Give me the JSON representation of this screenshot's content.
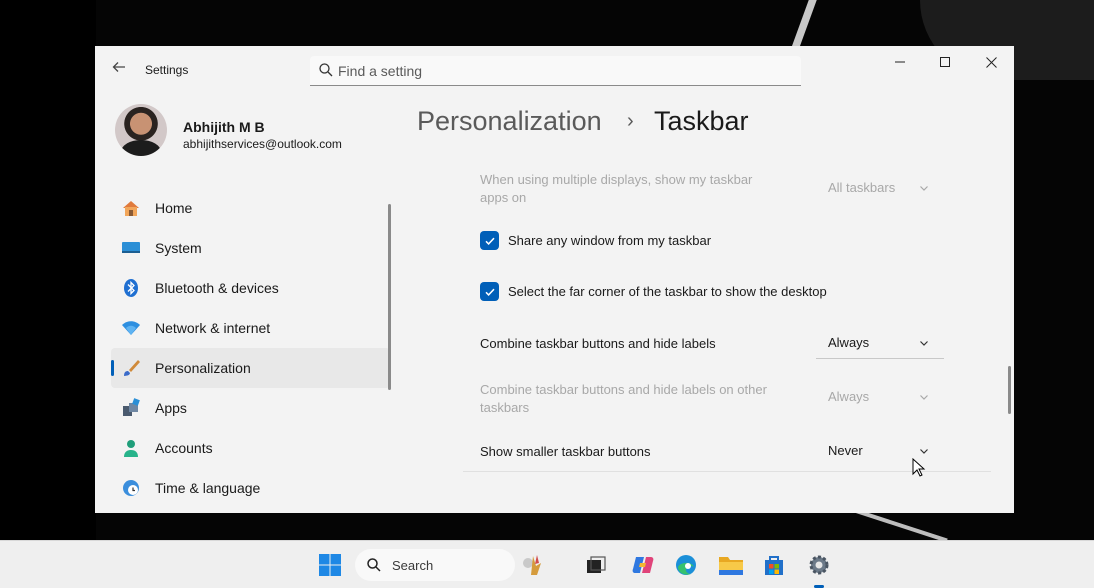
{
  "window": {
    "app_title": "Settings",
    "search_placeholder": "Find a setting"
  },
  "profile": {
    "name": "Abhijith M B",
    "email": "abhijithservices@outlook.com"
  },
  "nav": {
    "items": [
      {
        "label": "Home",
        "icon": "home-icon"
      },
      {
        "label": "System",
        "icon": "system-icon"
      },
      {
        "label": "Bluetooth & devices",
        "icon": "bluetooth-icon"
      },
      {
        "label": "Network & internet",
        "icon": "wifi-icon"
      },
      {
        "label": "Personalization",
        "icon": "brush-icon",
        "active": true
      },
      {
        "label": "Apps",
        "icon": "apps-icon"
      },
      {
        "label": "Accounts",
        "icon": "accounts-icon"
      },
      {
        "label": "Time & language",
        "icon": "globe-clock-icon"
      }
    ]
  },
  "header": {
    "parent": "Personalization",
    "separator": "›",
    "current": "Taskbar"
  },
  "settings": {
    "multi_display": {
      "label": "When using multiple displays, show my taskbar apps on",
      "value": "All taskbars",
      "disabled": true
    },
    "share_window": {
      "label": "Share any window from my taskbar",
      "checked": true
    },
    "far_corner": {
      "label": "Select the far corner of the taskbar to show the desktop",
      "checked": true
    },
    "combine": {
      "label": "Combine taskbar buttons and hide labels",
      "value": "Always"
    },
    "combine_other": {
      "label": "Combine taskbar buttons and hide labels on other taskbars",
      "value": "Always",
      "disabled": true
    },
    "smaller_buttons": {
      "label": "Show smaller taskbar buttons",
      "value": "Never"
    }
  },
  "taskbar": {
    "search_label": "Search",
    "apps": [
      "start-icon",
      "widgets-icon",
      "task-view-icon",
      "copilot-icon",
      "edge-icon",
      "file-explorer-icon",
      "store-icon",
      "settings-icon"
    ],
    "accent_color": "#005fb8"
  }
}
